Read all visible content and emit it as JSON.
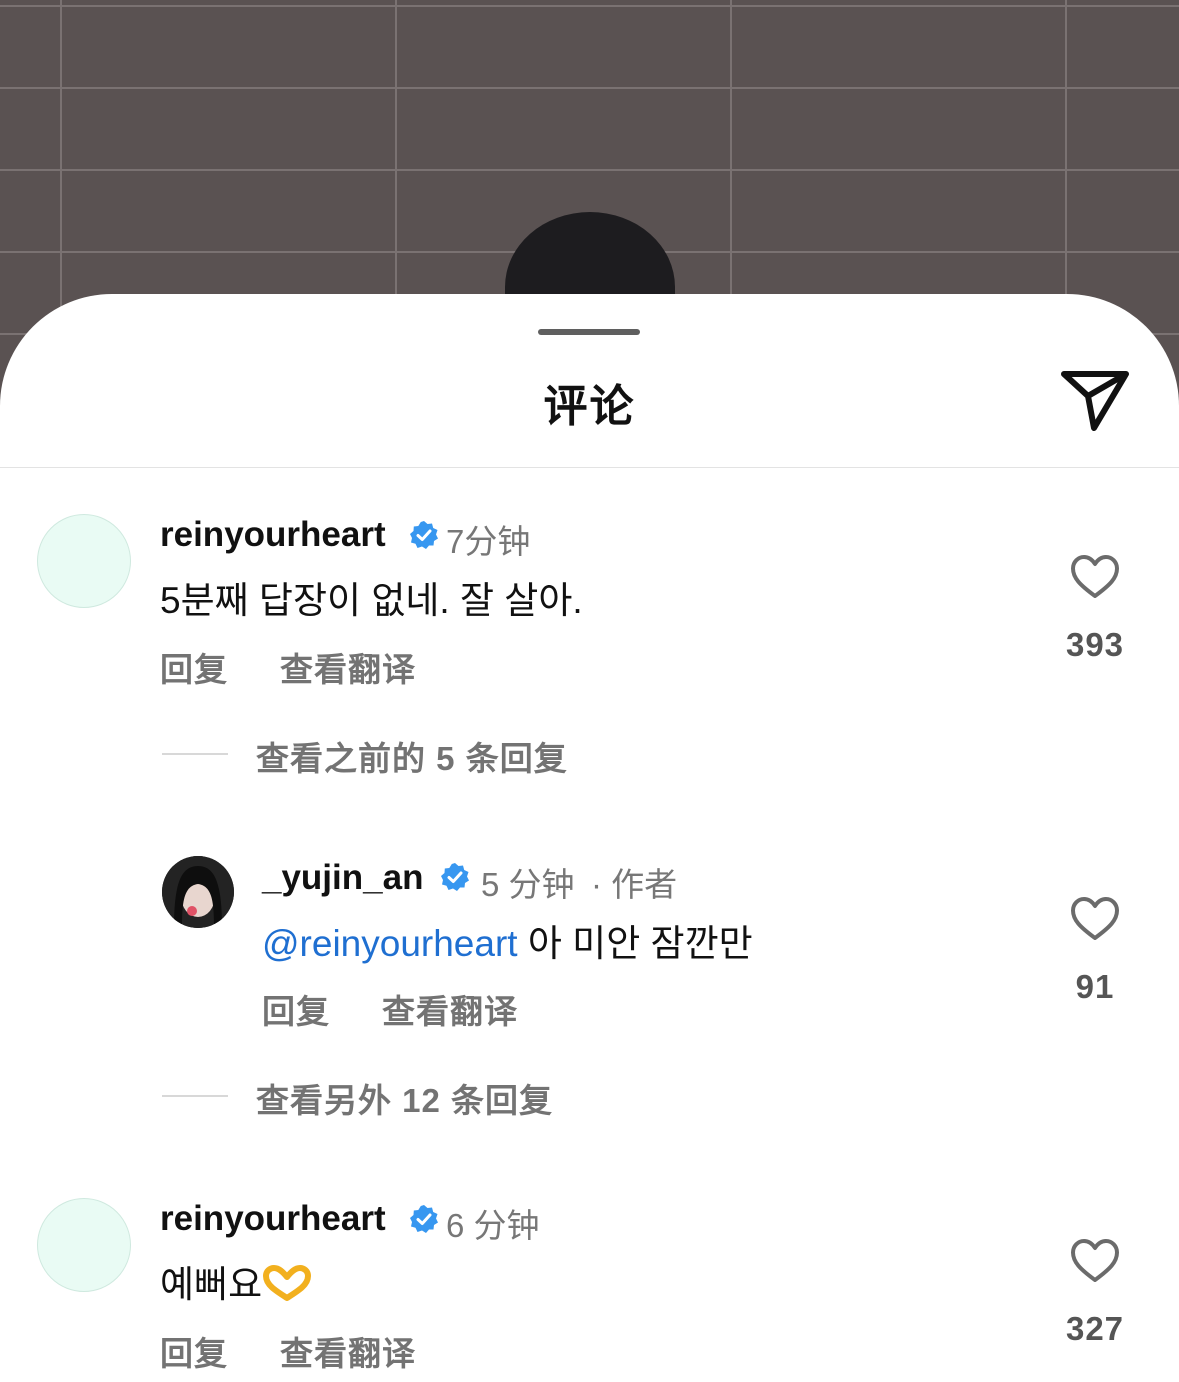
{
  "sheet": {
    "title": "评论"
  },
  "comments": [
    {
      "username": "reinyourheart",
      "time": "7分钟",
      "text": "5분째 답장이 없네. 잘 살아.",
      "reply_label": "回复",
      "translate_label": "查看翻译",
      "likes": "393",
      "view_replies": "查看之前的 5 条回复"
    },
    {
      "username": "_yujin_an",
      "time": "5 分钟",
      "author_tag": "· 作者",
      "mention": "@reinyourheart",
      "text": "아 미안 잠깐만",
      "reply_label": "回复",
      "translate_label": "查看翻译",
      "likes": "91",
      "view_replies": "查看另外 12 条回复"
    },
    {
      "username": "reinyourheart",
      "time": "6 分钟",
      "text": "예뻐요",
      "reply_label": "回复",
      "translate_label": "查看翻译",
      "likes": "327"
    }
  ],
  "colors": {
    "mention": "#1f6fd1",
    "verified": "#3797f0",
    "muted_text": "#737373"
  },
  "icons": [
    "send-icon",
    "verified-badge-icon",
    "heart-icon",
    "heart-hands-emoji-icon"
  ]
}
